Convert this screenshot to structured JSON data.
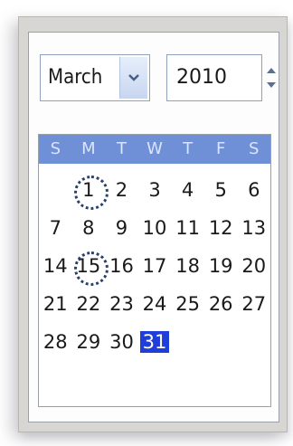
{
  "header": {
    "month_value": "March",
    "year_value": "2010"
  },
  "icons": {
    "month_dropdown": "chevron-down-icon",
    "year_up": "chevron-up-icon",
    "year_down": "chevron-down-icon"
  },
  "colors": {
    "dow_header_bg": "#6f8fd6",
    "selected_bg": "#1f3fd8",
    "today_ring": "#2a3f6e"
  },
  "calendar": {
    "day_headers": [
      "S",
      "M",
      "T",
      "W",
      "T",
      "F",
      "S"
    ],
    "weeks": [
      [
        "",
        "1",
        "2",
        "3",
        "4",
        "5",
        "6"
      ],
      [
        "7",
        "8",
        "9",
        "10",
        "11",
        "12",
        "13"
      ],
      [
        "14",
        "15",
        "16",
        "17",
        "18",
        "19",
        "20"
      ],
      [
        "21",
        "22",
        "23",
        "24",
        "25",
        "26",
        "27"
      ],
      [
        "28",
        "29",
        "30",
        "31",
        "",
        "",
        ""
      ]
    ],
    "circled_days": [
      "1",
      "15"
    ],
    "selected_day": "31"
  }
}
